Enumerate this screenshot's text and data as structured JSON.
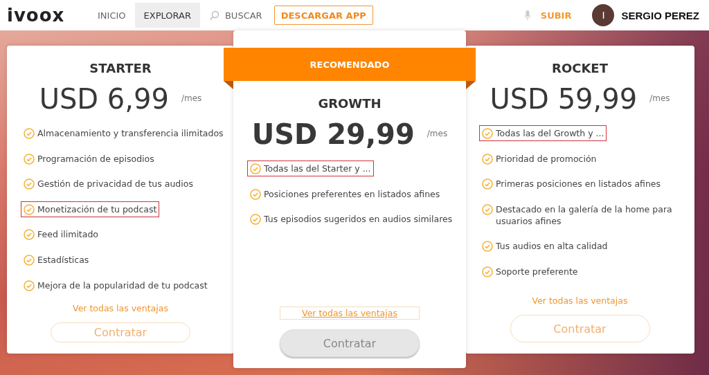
{
  "header": {
    "logo": "ivoox",
    "nav": [
      {
        "label": "INICIO",
        "kind": "link",
        "selected": false
      },
      {
        "label": "EXPLORAR",
        "kind": "link",
        "selected": true
      },
      {
        "label": "BUSCAR",
        "kind": "search",
        "selected": false
      },
      {
        "label": "DESCARGAR APP",
        "kind": "outlined",
        "selected": false
      }
    ],
    "upload": "SUBIR",
    "avatar_letter": "I",
    "user_name": "SERGIO PEREZ"
  },
  "plans": [
    {
      "name": "STARTER",
      "featured": false,
      "price": "USD 6,99",
      "period": "/mes",
      "features": [
        {
          "text": "Almacenamiento y transferencia ilimitados",
          "highlighted": false
        },
        {
          "text": "Programación de episodios",
          "highlighted": false
        },
        {
          "text": "Gestión de privacidad de tus audios",
          "highlighted": false
        },
        {
          "text": "Monetización de tu podcast",
          "highlighted": true
        },
        {
          "text": "Feed ilimitado",
          "highlighted": false
        },
        {
          "text": "Estadísticas",
          "highlighted": false
        },
        {
          "text": "Mejora de la popularidad de tu podcast",
          "highlighted": false
        }
      ],
      "link": "Ver todas las ventajas",
      "button": "Contratar"
    },
    {
      "name": "GROWTH",
      "featured": true,
      "badge": "RECOMENDADO",
      "price": "USD 29,99",
      "period": "/mes",
      "features": [
        {
          "text": "Todas las del Starter y ...",
          "highlighted": true
        },
        {
          "text": "Posiciones preferentes en listados afines",
          "highlighted": false
        },
        {
          "text": "Tus episodios sugeridos en audios similares",
          "highlighted": false
        }
      ],
      "link": "Ver todas las ventajas",
      "button": "Contratar"
    },
    {
      "name": "ROCKET",
      "featured": false,
      "price": "USD 59,99",
      "period": "/mes",
      "features": [
        {
          "text": "Todas las del Growth y ...",
          "highlighted": true
        },
        {
          "text": "Prioridad de promoción",
          "highlighted": false
        },
        {
          "text": "Primeras posiciones en listados afines",
          "highlighted": false
        },
        {
          "text": "Destacado en la galería de la home para usuarios afines",
          "highlighted": false
        },
        {
          "text": "Tus audios en alta calidad",
          "highlighted": false
        },
        {
          "text": "Soporte preferente",
          "highlighted": false
        }
      ],
      "link": "Ver todas las ventajas",
      "button": "Contratar"
    }
  ]
}
